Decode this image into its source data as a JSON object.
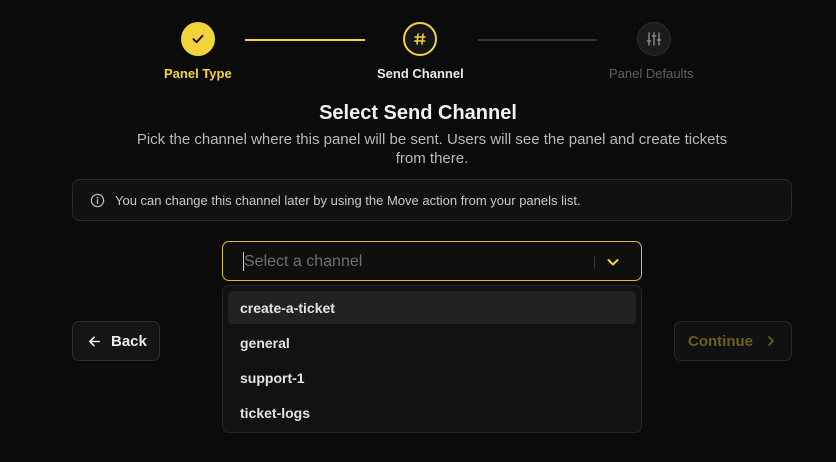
{
  "stepper": {
    "steps": [
      {
        "label": "Panel Type",
        "state": "completed",
        "icon": "check-icon"
      },
      {
        "label": "Send Channel",
        "state": "active",
        "icon": "hash-icon"
      },
      {
        "label": "Panel Defaults",
        "state": "pending",
        "icon": "sliders-icon"
      }
    ]
  },
  "header": {
    "title": "Select Send Channel",
    "description": "Pick the channel where this panel will be sent. Users will see the panel and create tickets from there."
  },
  "info": {
    "icon": "info-icon",
    "text": "You can change this channel later by using the Move action from your panels list."
  },
  "channel_select": {
    "placeholder": "Select a channel",
    "icon": "chevron-down-icon",
    "options": [
      "create-a-ticket",
      "general",
      "support-1",
      "ticket-logs"
    ],
    "highlighted": "create-a-ticket"
  },
  "actions": {
    "back_label": "Back",
    "continue_label": "Continue"
  },
  "colors": {
    "accent": "#f2d43a",
    "background": "#0b0b0b",
    "disabled_accent": "#6b6018"
  }
}
